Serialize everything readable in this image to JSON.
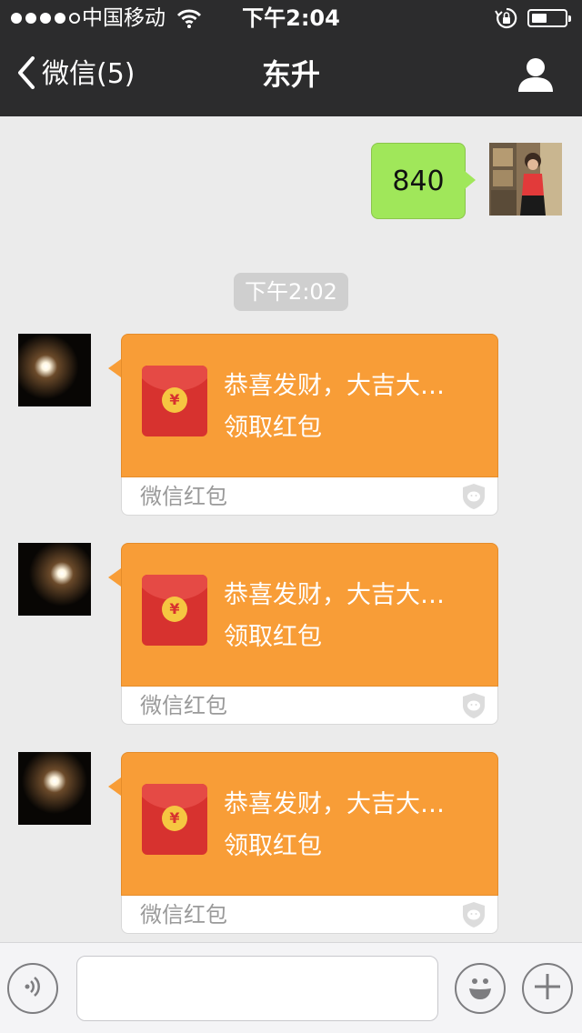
{
  "status_bar": {
    "carrier": "中国移动",
    "time": "下午2:04",
    "signal_bars_filled": 4,
    "signal_bars_total": 5,
    "battery_level": 0.45,
    "icons": [
      "signal-dots",
      "wifi-icon",
      "rotation-lock-icon",
      "battery-icon"
    ]
  },
  "nav": {
    "back_label": "微信(5)",
    "title": "东升",
    "icons": {
      "back": "chevron-left-icon",
      "profile": "person-icon"
    }
  },
  "messages": {
    "outgoing_text": "840",
    "timestamp": "下午2:02",
    "red_packets": [
      {
        "title": "恭喜发财，大吉大…",
        "action": "领取红包",
        "footer": "微信红包"
      },
      {
        "title": "恭喜发财，大吉大…",
        "action": "领取红包",
        "footer": "微信红包"
      },
      {
        "title": "恭喜发财，大吉大…",
        "action": "领取红包",
        "footer": "微信红包"
      }
    ]
  },
  "input_bar": {
    "text_value": "",
    "icons": {
      "voice": "voice-icon",
      "emoji": "emoji-icon",
      "more": "plus-icon"
    }
  },
  "colors": {
    "nav_bg": "#2c2c2d",
    "chat_bg": "#ebebeb",
    "outgoing_bubble": "#a0e75a",
    "red_packet": "#f89d37",
    "envelope": "#d7322f"
  }
}
